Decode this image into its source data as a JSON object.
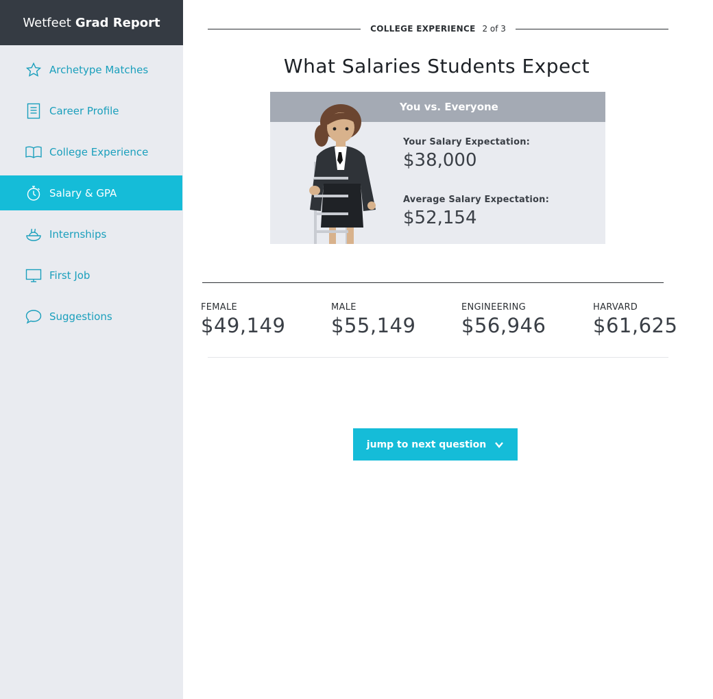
{
  "brand": {
    "light": "Wetfeet",
    "bold": "Grad Report"
  },
  "sidebar": {
    "items": [
      {
        "label": "Archetype Matches",
        "icon": "star-icon"
      },
      {
        "label": "Career Profile",
        "icon": "document-icon"
      },
      {
        "label": "College Experience",
        "icon": "book-icon"
      },
      {
        "label": "Salary & GPA",
        "icon": "stopwatch-icon",
        "active": true
      },
      {
        "label": "Internships",
        "icon": "bowl-icon"
      },
      {
        "label": "First Job",
        "icon": "monitor-icon"
      },
      {
        "label": "Suggestions",
        "icon": "speech-bubble-icon"
      }
    ]
  },
  "section": {
    "name": "COLLEGE EXPERIENCE",
    "progress": "2 of 3"
  },
  "page": {
    "title": "What Salaries Students Expect"
  },
  "card": {
    "header": "You vs. Everyone",
    "your_label": "Your Salary Expectation:",
    "your_value": "$38,000",
    "avg_label": "Average Salary Expectation:",
    "avg_value": "$52,154"
  },
  "stats": [
    {
      "label": "FEMALE",
      "value": "$49,149"
    },
    {
      "label": "MALE",
      "value": "$55,149"
    },
    {
      "label": "ENGINEERING",
      "value": "$56,946"
    },
    {
      "label": "HARVARD",
      "value": "$61,625"
    }
  ],
  "next_button": {
    "label": "jump to next question"
  },
  "colors": {
    "accent": "#15bcd8",
    "sidebar_bg": "#e9ebf0",
    "brand_bg": "#353b43",
    "card_header": "#a4aab4",
    "link": "#1a9fbc"
  }
}
